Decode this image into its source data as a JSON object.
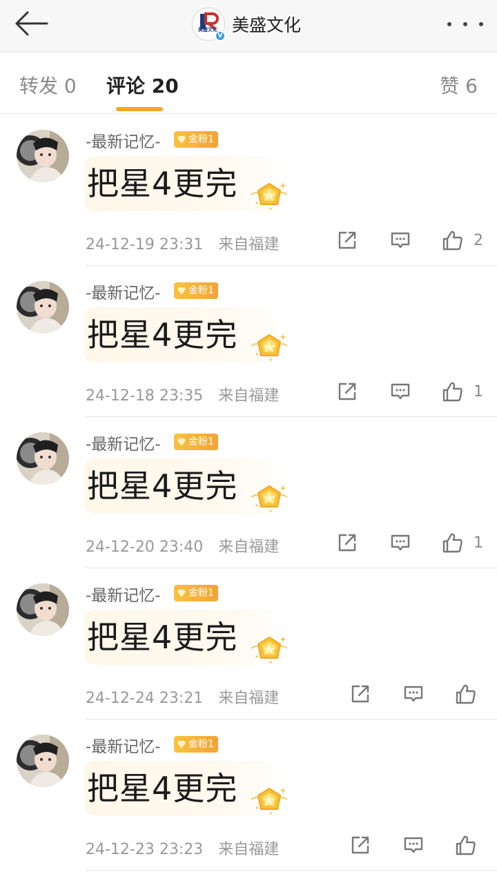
{
  "header": {
    "title": "美盛文化",
    "logo_text": "美盛文化",
    "verified_mark": "V",
    "back_icon": "arrow-left-icon",
    "more_icon": "more-dots-icon"
  },
  "tabs": [
    {
      "label": "转发 0"
    },
    {
      "label": "评论 20"
    },
    {
      "label": "赞 6"
    }
  ],
  "active_tab": "评论 20",
  "colors": {
    "accent": "#f5a623",
    "badge": "#f3a33a",
    "meta_text": "#999999"
  },
  "comments": [
    {
      "user": "-最新记忆-",
      "badge": "金粉1",
      "text": "把星4更完",
      "time": "24-12-19 23:31",
      "location": "来自福建",
      "likes": "2"
    },
    {
      "user": "-最新记忆-",
      "badge": "金粉1",
      "text": "把星4更完",
      "time": "24-12-18 23:35",
      "location": "来自福建",
      "likes": "1"
    },
    {
      "user": "-最新记忆-",
      "badge": "金粉1",
      "text": "把星4更完",
      "time": "24-12-20 23:40",
      "location": "来自福建",
      "likes": "1"
    },
    {
      "user": "-最新记忆-",
      "badge": "金粉1",
      "text": "把星4更完",
      "time": "24-12-24 23:21",
      "location": "来自福建",
      "likes": ""
    },
    {
      "user": "-最新记忆-",
      "badge": "金粉1",
      "text": "把星4更完",
      "time": "24-12-23 23:23",
      "location": "来自福建",
      "likes": ""
    }
  ]
}
